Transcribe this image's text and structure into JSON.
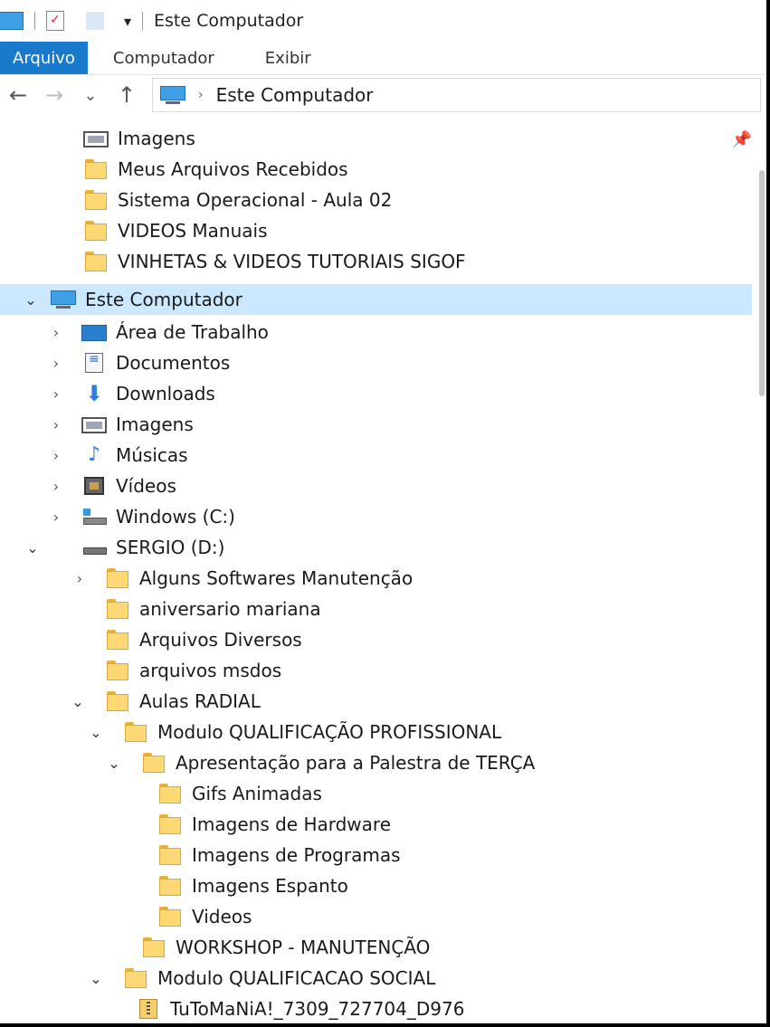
{
  "window": {
    "title": "Este Computador",
    "qat_dropdown": "▾"
  },
  "ribbon": {
    "tabs": [
      "Arquivo",
      "Computador",
      "Exibir"
    ]
  },
  "nav": {
    "back": "←",
    "forward": "→",
    "recent": "⌄",
    "up": "↑",
    "crumb_separator": "›",
    "address": "Este Computador"
  },
  "quick_access": [
    {
      "label": "Imagens",
      "icon": "pictures-icon"
    },
    {
      "label": "Meus Arquivos Recebidos",
      "icon": "folder-icon"
    },
    {
      "label": "Sistema Operacional - Aula 02",
      "icon": "folder-icon"
    },
    {
      "label": "VIDEOS Manuais",
      "icon": "folder-icon"
    },
    {
      "label": "VINHETAS & VIDEOS TUTORIAIS SIGOF",
      "icon": "folder-icon"
    }
  ],
  "this_pc": {
    "label": "Este Computador",
    "children": [
      {
        "label": "Área de Trabalho",
        "icon": "desktop-icon"
      },
      {
        "label": "Documentos",
        "icon": "documents-icon"
      },
      {
        "label": "Downloads",
        "icon": "downloads-icon"
      },
      {
        "label": "Imagens",
        "icon": "pictures-icon"
      },
      {
        "label": "Músicas",
        "icon": "music-icon"
      },
      {
        "label": "Vídeos",
        "icon": "videos-icon"
      },
      {
        "label": "Windows (C:)",
        "icon": "windows-drive-icon"
      },
      {
        "label": "SERGIO (D:)",
        "icon": "drive-icon"
      }
    ]
  },
  "drive_d": [
    {
      "label": "Alguns Softwares Manutenção"
    },
    {
      "label": "aniversario mariana"
    },
    {
      "label": "Arquivos Diversos"
    },
    {
      "label": "arquivos msdos"
    },
    {
      "label": "Aulas RADIAL"
    },
    {
      "label": "Modulo QUALIFICAÇÃO PROFISSIONAL"
    },
    {
      "label": "Apresentação para a Palestra de TERÇA"
    },
    {
      "label": "Gifs Animadas"
    },
    {
      "label": "Imagens de Hardware"
    },
    {
      "label": "Imagens de Programas"
    },
    {
      "label": "Imagens Espanto"
    },
    {
      "label": "Videos"
    },
    {
      "label": "WORKSHOP - MANUTENÇÃO"
    },
    {
      "label": "Modulo QUALIFICACAO SOCIAL"
    },
    {
      "label": "TuToMaNiA!_7309_727704_D976"
    }
  ],
  "glyphs": {
    "collapsed": "›",
    "expanded": "⌄",
    "pin": "📌"
  }
}
